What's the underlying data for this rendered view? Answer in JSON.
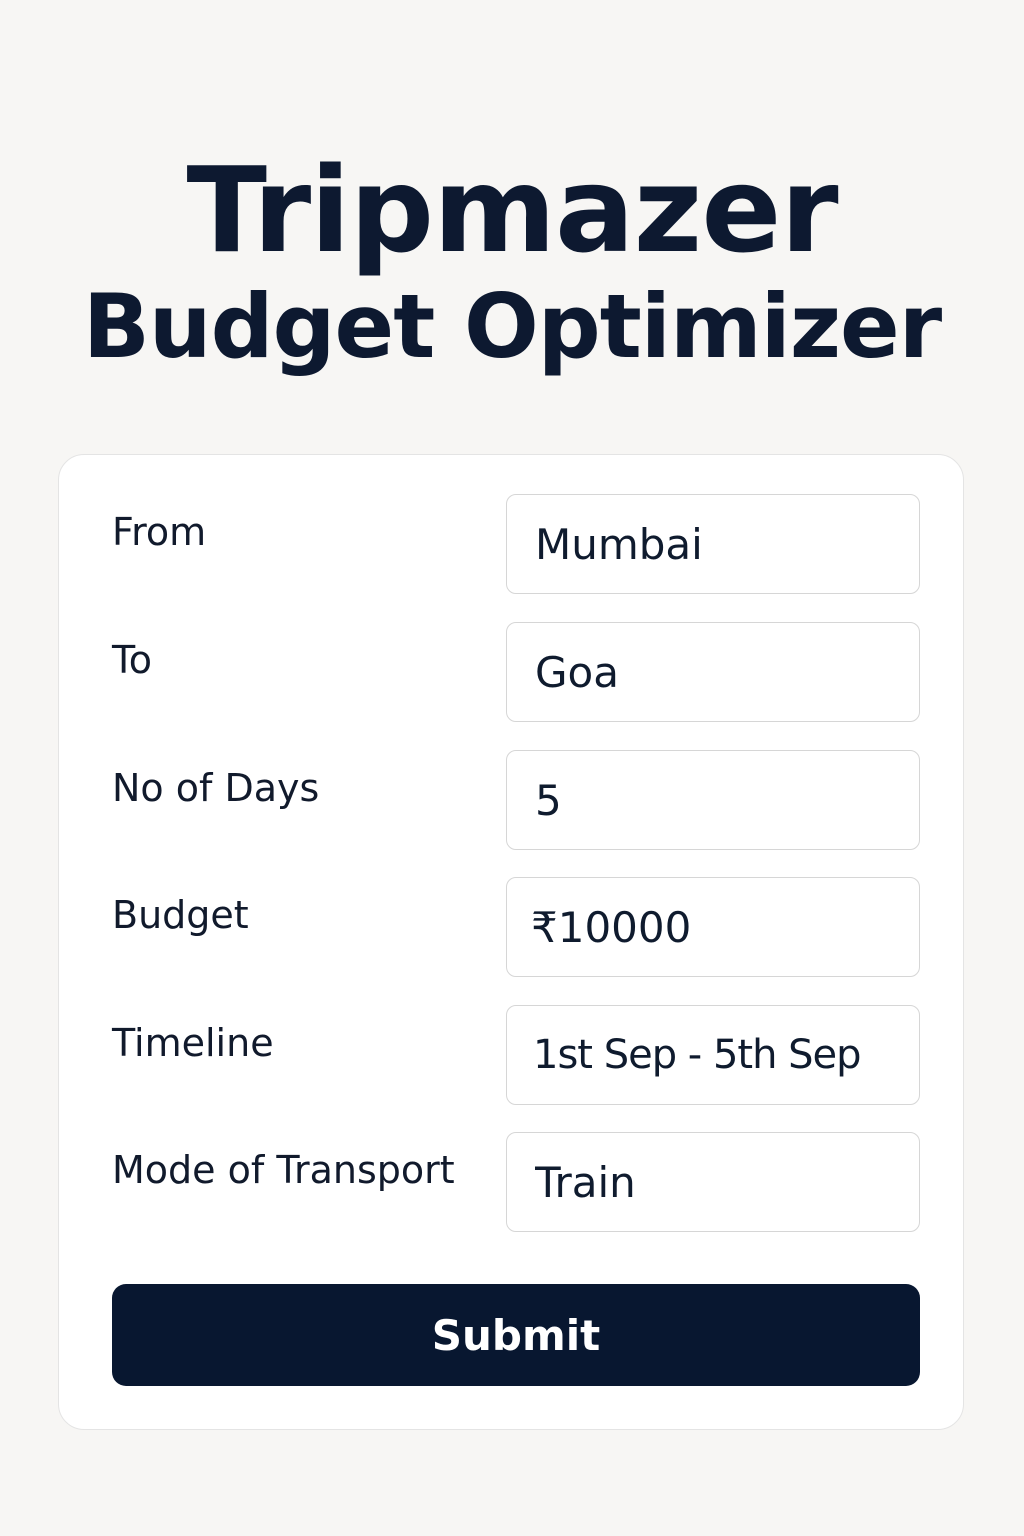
{
  "header": {
    "title_line1": "Tripmazer",
    "title_line2": "Budget Optimizer"
  },
  "form": {
    "fields": [
      {
        "label": "From",
        "value": "Mumbai"
      },
      {
        "label": "To",
        "value": "Goa"
      },
      {
        "label": "No of Days",
        "value": "5"
      },
      {
        "label": "Budget",
        "value": "₹10000"
      },
      {
        "label": "Timeline",
        "value": "1st Sep - 5th Sep"
      },
      {
        "label": "Mode of Transport",
        "value": "Train"
      }
    ],
    "submit_label": "Submit"
  },
  "colors": {
    "background": "#f7f6f4",
    "card": "#ffffff",
    "primary_dark": "#081730",
    "text": "#0d1930"
  }
}
